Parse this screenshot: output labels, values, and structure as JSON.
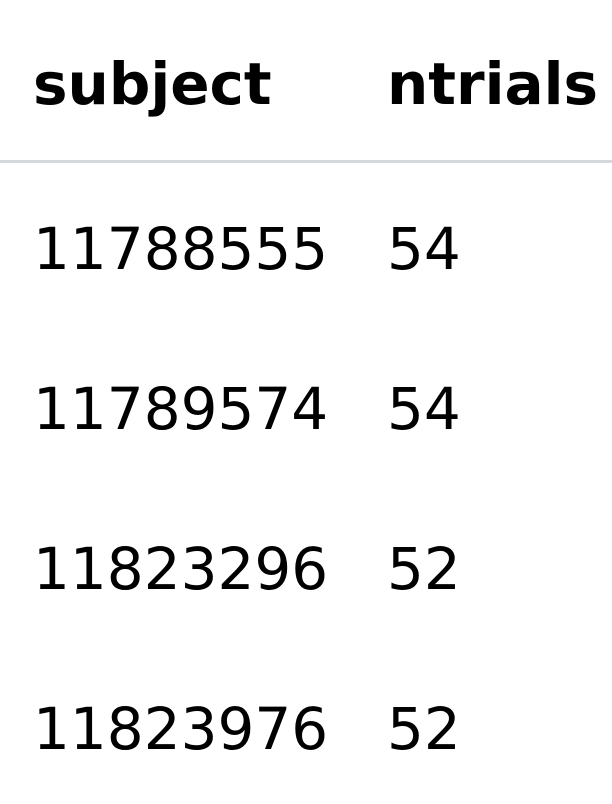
{
  "table": {
    "columns": [
      "subject",
      "ntrials"
    ],
    "rows": [
      {
        "subject": "11788555",
        "ntrials": "54"
      },
      {
        "subject": "11789574",
        "ntrials": "54"
      },
      {
        "subject": "11823296",
        "ntrials": "52"
      },
      {
        "subject": "11823976",
        "ntrials": "52"
      }
    ]
  }
}
